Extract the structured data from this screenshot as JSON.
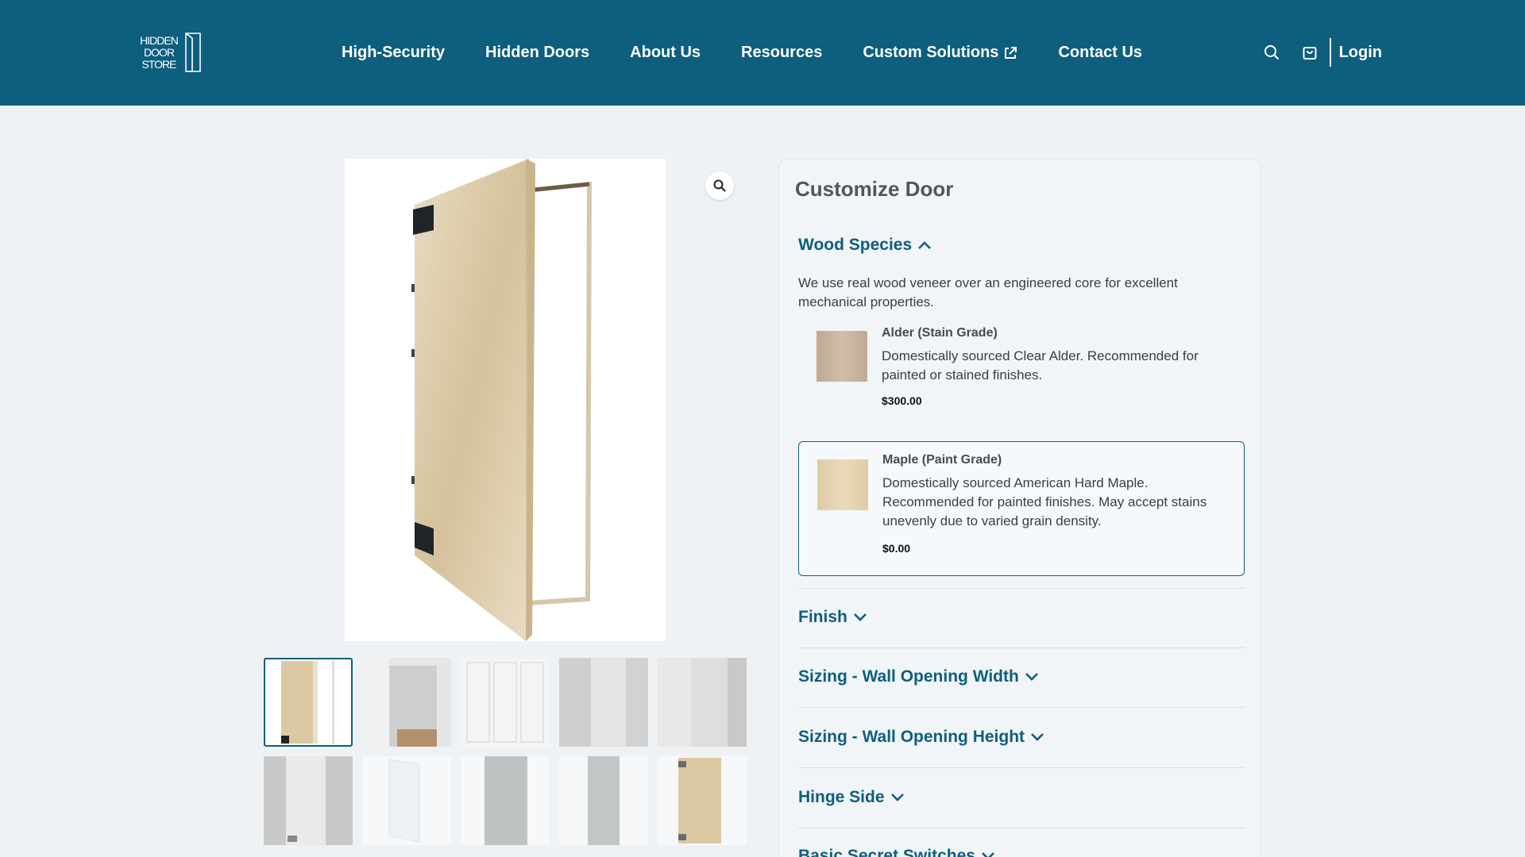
{
  "header": {
    "logo": {
      "text": "HIDDEN\nDOOR\nSTORE"
    },
    "nav": [
      {
        "label": "High-Security"
      },
      {
        "label": "Hidden Doors"
      },
      {
        "label": "About Us"
      },
      {
        "label": "Resources"
      },
      {
        "label": "Custom Solutions",
        "icon": "external-link-icon"
      },
      {
        "label": "Contact Us"
      }
    ],
    "actions": {
      "search_icon": "search-icon",
      "cart_icon": "shopping-bag-icon",
      "login_label": "Login"
    }
  },
  "gallery": {
    "zoom_icon": "magnifier-icon",
    "thumbnails_count_visible": 10
  },
  "customize": {
    "title": "Customize Door",
    "sections": [
      {
        "label": "Wood Species",
        "expanded": true
      },
      {
        "label": "Finish",
        "expanded": false
      },
      {
        "label": "Sizing - Wall Opening Width",
        "expanded": false
      },
      {
        "label": "Sizing - Wall Opening Height",
        "expanded": false
      },
      {
        "label": "Hinge Side",
        "expanded": false
      },
      {
        "label": "Basic Secret Switches",
        "expanded": false
      }
    ],
    "wood_species": {
      "description": "We use real wood veneer over an engineered core for excellent mechanical properties.",
      "options": [
        {
          "name": "Alder (Stain Grade)",
          "description": "Domestically sourced Clear Alder. Recommended for painted or stained finishes.",
          "price": "$300.00",
          "selected": false,
          "swatch_color": "#c9b39e"
        },
        {
          "name": "Maple (Paint Grade)",
          "description": "Domestically sourced American Hard Maple. Recommended for painted finishes. May accept stains unevenly due to varied grain density.",
          "price": "$0.00",
          "selected": true,
          "swatch_color": "#e4d2ae"
        }
      ]
    }
  },
  "colors": {
    "brand": "#0e5e7e",
    "page_bg": "#eef2f5",
    "panel_bg": "#f1f5f7"
  }
}
